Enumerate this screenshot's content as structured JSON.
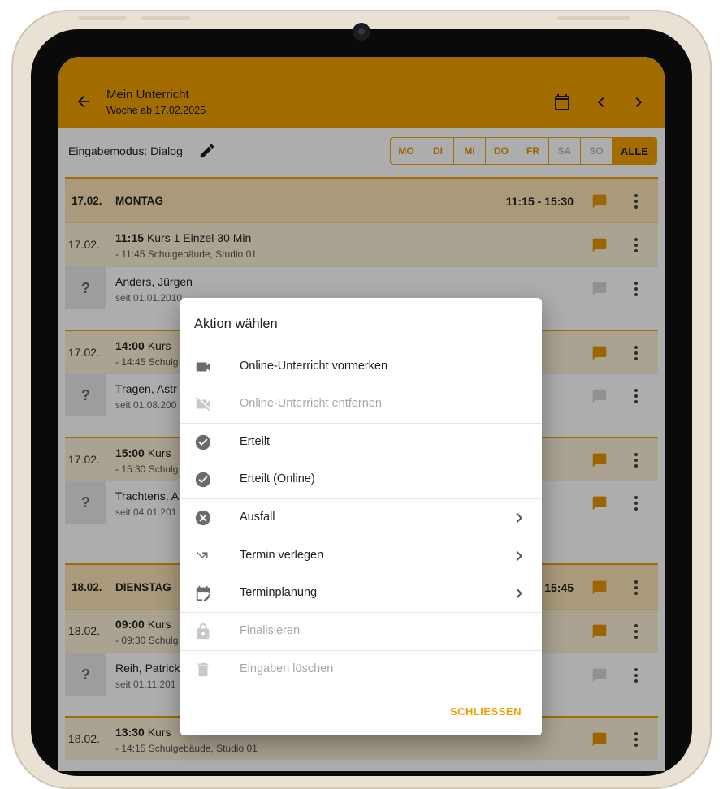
{
  "appbar": {
    "title": "Mein Unterricht",
    "subtitle": "Woche ab 17.02.2025"
  },
  "toolbar": {
    "mode_label": "Eingabemodus: Dialog",
    "days": [
      {
        "label": "MO"
      },
      {
        "label": "DI"
      },
      {
        "label": "MI"
      },
      {
        "label": "DO"
      },
      {
        "label": "FR"
      },
      {
        "label": "SA"
      },
      {
        "label": "SO"
      },
      {
        "label": "ALLE"
      }
    ]
  },
  "schedule": {
    "day1": {
      "date": "17.02.",
      "name": "MONTAG",
      "time": "11:15 - 15:30"
    },
    "lesson1": {
      "date": "17.02.",
      "time": "11:15",
      "course": "Kurs 1 Einzel 30 Min",
      "detail": "- 11:45 Schulgebäude, Studio 01"
    },
    "student1": {
      "q": "?",
      "name": "Anders, Jürgen",
      "since": "seit 01.01.2010"
    },
    "lesson2": {
      "date": "17.02.",
      "time": "14:00",
      "course": "Kurs",
      "detail": "- 14:45 Schulg"
    },
    "student2": {
      "q": "?",
      "name": "Tragen, Astr",
      "since": "seit 01.08.200"
    },
    "lesson3": {
      "date": "17.02.",
      "time": "15:00",
      "course": "Kurs",
      "detail": "- 15:30 Schulg"
    },
    "student3": {
      "q": "?",
      "name": "Trachtens, A",
      "since": "seit 04.01.201"
    },
    "day2": {
      "date": "18.02.",
      "name": "DIENSTAG",
      "time": "15:45"
    },
    "lesson4": {
      "date": "18.02.",
      "time": "09:00",
      "course": "Kurs",
      "detail": "- 09:30 Schulg"
    },
    "student4": {
      "q": "?",
      "name": "Reih, Patrick",
      "since": "seit 01.11.201"
    },
    "lesson5": {
      "date": "18.02.",
      "time": "13:30",
      "course": "Kurs",
      "detail": "- 14:15 Schulgebäude, Studio 01"
    }
  },
  "dialog": {
    "title": "Aktion wählen",
    "items": [
      {
        "label": "Online-Unterricht vormerken",
        "icon": "videocam-icon"
      },
      {
        "label": "Online-Unterricht entfernen",
        "icon": "videocam-off-icon"
      },
      {
        "label": "Erteilt",
        "icon": "check-circle-icon"
      },
      {
        "label": "Erteilt (Online)",
        "icon": "check-circle-icon"
      },
      {
        "label": "Ausfall",
        "icon": "cancel-circle-icon"
      },
      {
        "label": "Termin verlegen",
        "icon": "move-arrow-icon"
      },
      {
        "label": "Terminplanung",
        "icon": "calendar-edit-icon"
      },
      {
        "label": "Finalisieren",
        "icon": "lock-icon"
      },
      {
        "label": "Eingaben löschen",
        "icon": "trash-icon"
      }
    ],
    "close_label": "SCHLIESSEN"
  },
  "colors": {
    "accent": "#f0a000",
    "header_row": "#fbe3b5",
    "lesson_row": "#fdf0d6"
  }
}
